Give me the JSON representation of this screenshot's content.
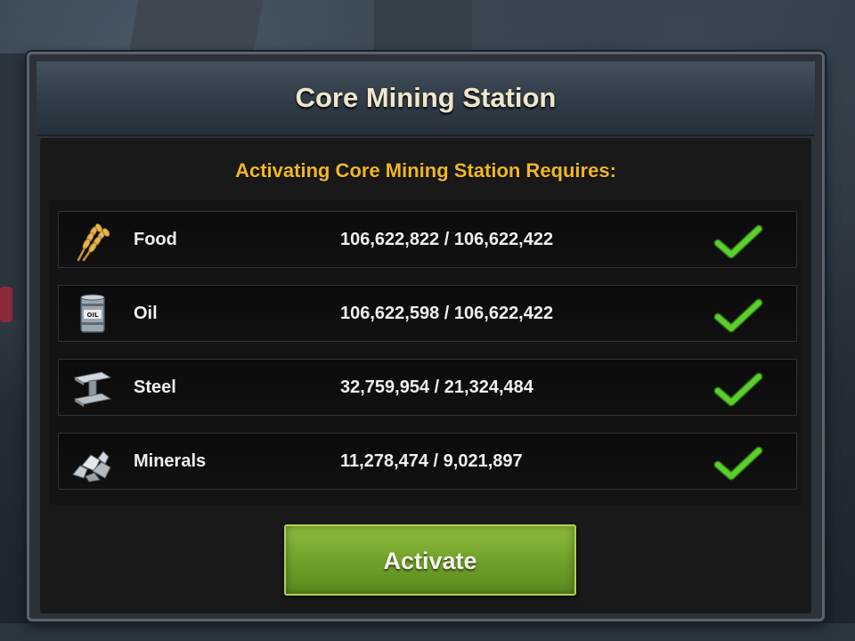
{
  "dialog": {
    "title": "Core Mining Station",
    "subtitle": "Activating Core Mining Station Requires:",
    "resources": [
      {
        "name": "Food",
        "amount": "106,622,822 / 106,622,422",
        "icon": "wheat-icon",
        "met": true
      },
      {
        "name": "Oil",
        "amount": "106,622,598 / 106,622,422",
        "icon": "oil-barrel-icon",
        "met": true
      },
      {
        "name": "Steel",
        "amount": "32,759,954 / 21,324,484",
        "icon": "steel-beam-icon",
        "met": true
      },
      {
        "name": "Minerals",
        "amount": "11,278,474 / 9,021,897",
        "icon": "minerals-icon",
        "met": true
      }
    ],
    "activate_label": "Activate"
  },
  "colors": {
    "title": "#efe6cc",
    "subtitle": "#f2b623",
    "check": "#5ccf2e",
    "button": "#7aa72f"
  }
}
